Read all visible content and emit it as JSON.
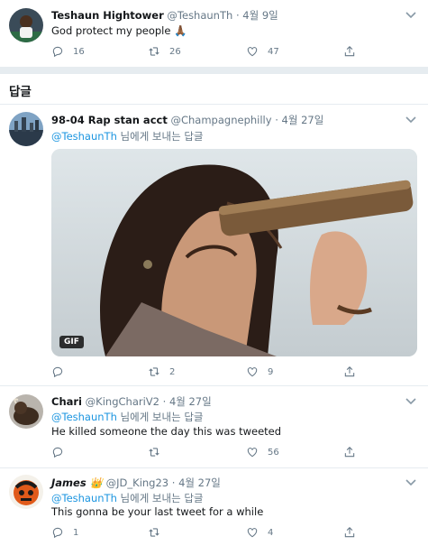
{
  "main_tweet": {
    "name": "Teshaun Hightower",
    "handle": "@TeshaunTh",
    "date": "4월 9일",
    "text": "God protect my people 🙏🏾",
    "counts": {
      "reply": "16",
      "retweet": "26",
      "like": "47"
    }
  },
  "replies_header": "답글",
  "replies": [
    {
      "name": "98-04 Rap stan acct",
      "handle": "@Champagnephilly",
      "date": "4월 27일",
      "reply_mention": "@TeshaunTh",
      "reply_suffix": " 님에게 보내는 답글",
      "media_badge": "GIF",
      "counts": {
        "reply": "",
        "retweet": "2",
        "like": "9"
      }
    },
    {
      "name": "Chari",
      "handle": "@KingChariV2",
      "date": "4월 27일",
      "reply_mention": "@TeshaunTh",
      "reply_suffix": " 님에게 보내는 답글",
      "text": "He killed someone the day this was tweeted",
      "counts": {
        "reply": "",
        "retweet": "",
        "like": "56"
      }
    },
    {
      "name": "James 👑",
      "handle": "@JD_King23",
      "date": "4월 27일",
      "reply_mention": "@TeshaunTh",
      "reply_suffix": " 님에게 보내는 답글",
      "text": "This gonna be your last tweet for a while",
      "counts": {
        "reply": "1",
        "retweet": "",
        "like": "4"
      }
    }
  ],
  "colors": {
    "text": "#14171a",
    "muted": "#657786",
    "link": "#1b95e0",
    "divider": "#e6ecf0"
  },
  "icons": [
    "reply-icon",
    "retweet-icon",
    "like-icon",
    "share-icon",
    "caret-down-icon"
  ]
}
